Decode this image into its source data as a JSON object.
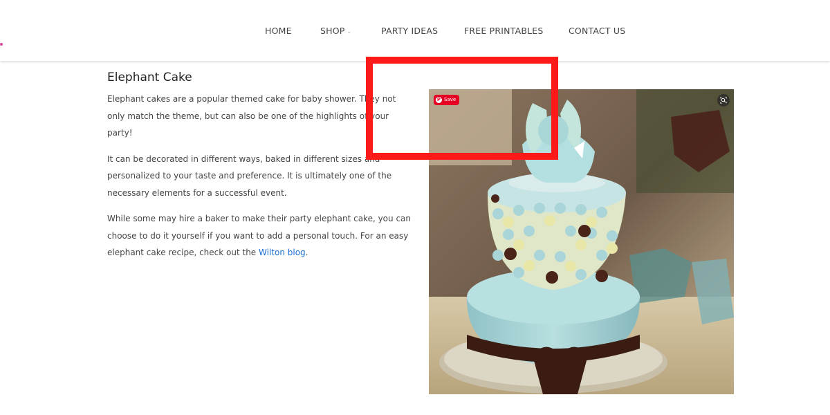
{
  "nav": {
    "items": [
      "HOME",
      "SHOP",
      "PARTY IDEAS",
      "FREE PRINTABLES",
      "CONTACT US"
    ]
  },
  "article": {
    "title": "Elephant Cake",
    "p1": "Elephant cakes are a popular themed cake for baby shower. They not only match the theme, but can also be one of the highlights of your party!",
    "p2": "It can be decorated in different ways, baked in different sizes and personalized to your taste and preference. It is ultimately one of the necessary elements for a successful event.",
    "p3_before": "While some may hire a baker to make their party elephant cake, you can choose to do it yourself if you want to add a personal touch. For an easy elephant cake recipe, check out the ",
    "p3_link": "Wilton blog",
    "p3_after": "."
  },
  "image": {
    "alt": "Elephant Cake",
    "save_label": "Save",
    "pin_icon": "pinterest-icon",
    "lens_icon": "visual-search-icon"
  },
  "colors": {
    "link": "#1a6fd1",
    "pin_save_bg": "#e60023",
    "highlight": "#ff1a1a"
  }
}
